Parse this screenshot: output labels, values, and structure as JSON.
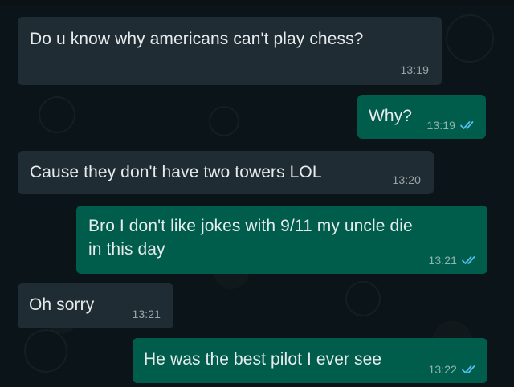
{
  "messages": [
    {
      "direction": "incoming",
      "text": "Do u know why americans can't play chess?",
      "time": "13:19",
      "read": false
    },
    {
      "direction": "outgoing",
      "text": "Why?",
      "time": "13:19",
      "read": true
    },
    {
      "direction": "incoming",
      "text": "Cause they don't have two towers LOL",
      "time": "13:20",
      "read": false
    },
    {
      "direction": "outgoing",
      "text_line1": "Bro I don't like jokes with 9/11 my uncle die",
      "text_line2": "in this day",
      "time": "13:21",
      "read": true
    },
    {
      "direction": "incoming",
      "text": "Oh sorry",
      "time": "13:21",
      "read": false
    },
    {
      "direction": "outgoing",
      "text": "He was the best pilot I ever see",
      "time": "13:22",
      "read": true
    }
  ],
  "colors": {
    "background": "#0b1418",
    "incoming_bubble": "#202c33",
    "outgoing_bubble": "#005c4b",
    "read_tick": "#53bdeb",
    "text": "#e7ebed"
  },
  "icons": {
    "read_receipt": "double-check-icon"
  }
}
